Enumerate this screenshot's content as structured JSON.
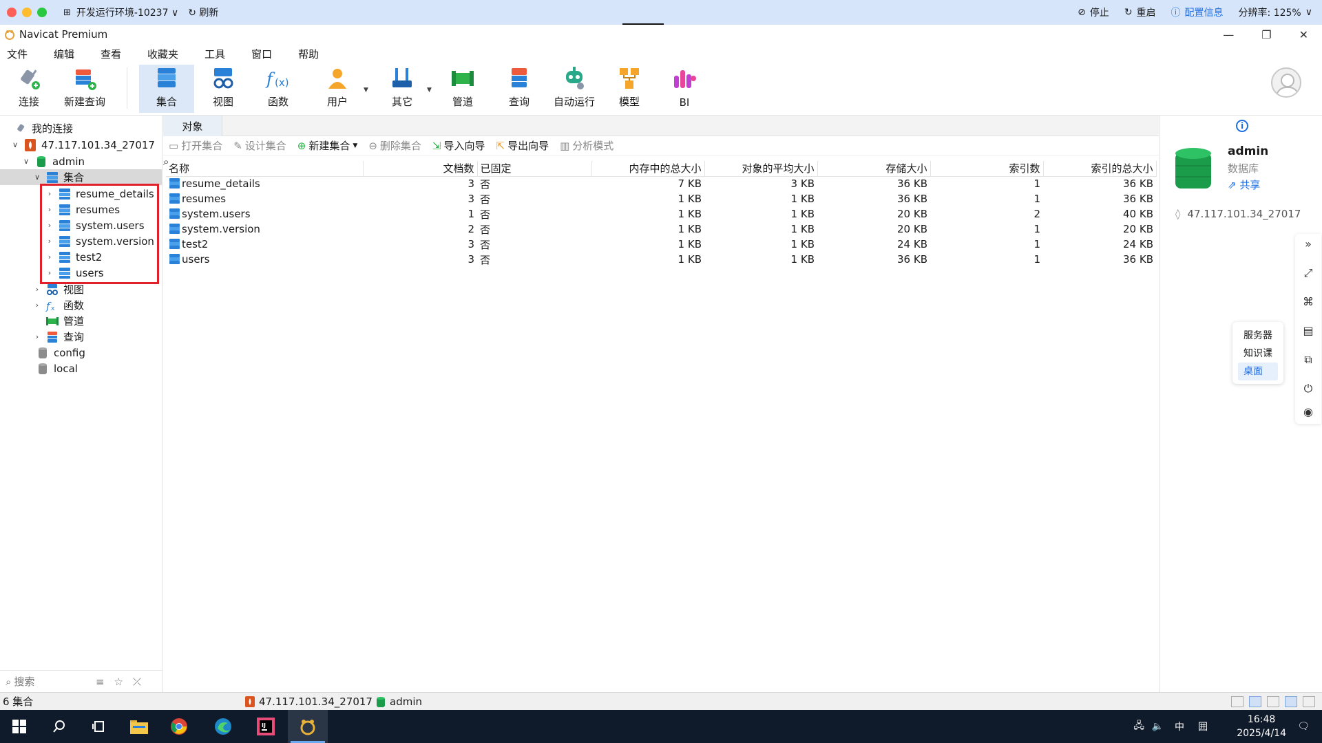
{
  "remote": {
    "env_label": "开发运行环境-10237",
    "refresh_label": "刷新",
    "stop_label": "停止",
    "restart_label": "重启",
    "config_label": "配置信息",
    "resolution_label": "分辨率: 125%"
  },
  "window": {
    "title": "Navicat Premium"
  },
  "menu": [
    "文件",
    "编辑",
    "查看",
    "收藏夹",
    "工具",
    "窗口",
    "帮助"
  ],
  "toolbar": {
    "connect": "连接",
    "new_query": "新建查询",
    "collection": "集合",
    "view": "视图",
    "function": "函数",
    "user": "用户",
    "other": "其它",
    "pipeline": "管道",
    "query": "查询",
    "automation": "自动运行",
    "model": "模型",
    "bi": "BI"
  },
  "sidebar": {
    "my_connections": "我的连接",
    "connection": "47.117.101.34_27017",
    "db_admin": "admin",
    "collections_node": "集合",
    "collections": [
      "resume_details",
      "resumes",
      "system.users",
      "system.version",
      "test2",
      "users"
    ],
    "views_node": "视图",
    "functions_node": "函数",
    "pipelines_node": "管道",
    "queries_node": "查询",
    "db_config": "config",
    "db_local": "local",
    "search_placeholder": "搜索"
  },
  "main": {
    "tab_label": "对象",
    "obj_toolbar": {
      "open": "打开集合",
      "design": "设计集合",
      "new": "新建集合",
      "delete": "删除集合",
      "import": "导入向导",
      "export": "导出向导",
      "analyze": "分析模式"
    },
    "columns": [
      "名称",
      "文档数",
      "已固定",
      "内存中的总大小",
      "对象的平均大小",
      "存储大小",
      "索引数",
      "索引的总大小"
    ],
    "rows": [
      [
        "resume_details",
        "3",
        "否",
        "7 KB",
        "3 KB",
        "36 KB",
        "1",
        "36 KB"
      ],
      [
        "resumes",
        "3",
        "否",
        "1 KB",
        "1 KB",
        "36 KB",
        "1",
        "36 KB"
      ],
      [
        "system.users",
        "1",
        "否",
        "1 KB",
        "1 KB",
        "20 KB",
        "2",
        "40 KB"
      ],
      [
        "system.version",
        "2",
        "否",
        "1 KB",
        "1 KB",
        "20 KB",
        "1",
        "20 KB"
      ],
      [
        "test2",
        "3",
        "否",
        "1 KB",
        "1 KB",
        "24 KB",
        "1",
        "24 KB"
      ],
      [
        "users",
        "3",
        "否",
        "1 KB",
        "1 KB",
        "36 KB",
        "1",
        "36 KB"
      ]
    ]
  },
  "info": {
    "db_name": "admin",
    "db_type": "数据库",
    "share": "共享",
    "host": "47.117.101.34_27017"
  },
  "float_menu": [
    "服务器",
    "知识课",
    "桌面"
  ],
  "status": {
    "count": "6 集合",
    "connection": "47.117.101.34_27017",
    "db": "admin"
  },
  "taskbar": {
    "time": "16:48",
    "date": "2025/4/14",
    "ime": "中"
  },
  "colors": {
    "accent": "#1f6fe0",
    "highlight_box": "#e0202a",
    "db_green": "#1a9c4a"
  }
}
